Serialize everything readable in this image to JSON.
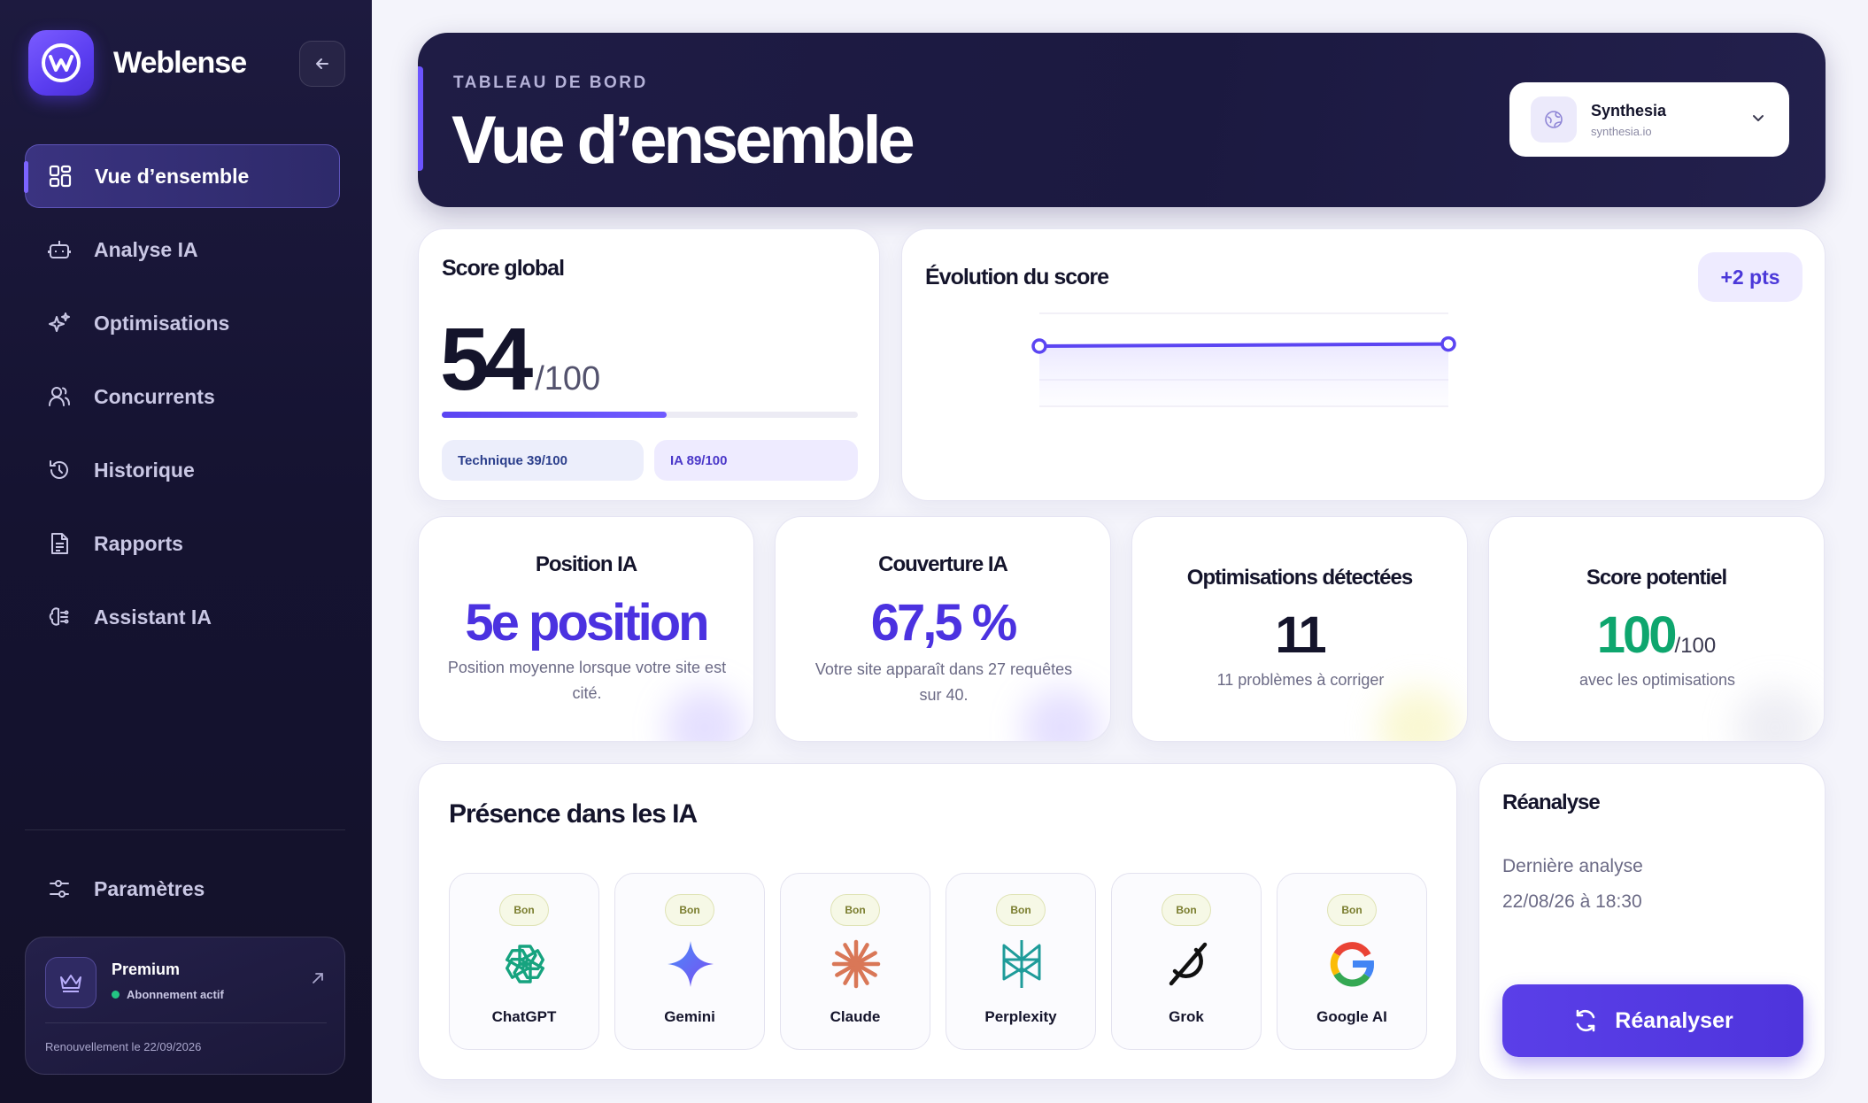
{
  "sidebar": {
    "brand_name": "Weblense",
    "nav": [
      {
        "label": "Vue d’ensemble",
        "icon": "grid-icon",
        "active": true
      },
      {
        "label": "Analyse IA",
        "icon": "robot-icon"
      },
      {
        "label": "Optimisations",
        "icon": "sparkles-icon"
      },
      {
        "label": "Concurrents",
        "icon": "users-icon"
      },
      {
        "label": "Historique",
        "icon": "history-icon"
      },
      {
        "label": "Rapports",
        "icon": "document-icon"
      },
      {
        "label": "Assistant IA",
        "icon": "brain-icon"
      }
    ],
    "settings_label": "Paramètres",
    "premium": {
      "title": "Premium",
      "status": "Abonnement actif",
      "renewal": "Renouvellement le 22/09/2026"
    }
  },
  "header": {
    "eyebrow": "TABLEAU DE BORD",
    "title": "Vue d’ensemble",
    "site": {
      "name": "Synthesia",
      "url": "synthesia.io"
    }
  },
  "score": {
    "title": "Score global",
    "value": "54",
    "max": "/100",
    "progress": 0.54,
    "technique": "Technique 39/100",
    "ia": "IA 89/100"
  },
  "evolution": {
    "title": "Évolution du score",
    "delta": "+2 pts",
    "chart_data": {
      "type": "line",
      "series": [
        {
          "values": [
            52,
            54
          ]
        }
      ],
      "grid": true
    }
  },
  "kpis": [
    {
      "title": "Position IA",
      "value": "5e position",
      "sub": "Position moyenne lorsque votre site est cité.",
      "color": "#4b32e0"
    },
    {
      "title": "Couverture IA",
      "value": "67,5 %",
      "sub": "Votre site apparaît dans 27 requêtes sur 40.",
      "color": "#4b32e0"
    },
    {
      "title": "Optimisations détectées",
      "value": "11",
      "sub": "11 problèmes à corriger",
      "color": "#14142b"
    },
    {
      "title": "Score potentiel",
      "value": "100",
      "value_suffix": "/100",
      "sub": "avec les optimisations",
      "color": "#0ea66e"
    }
  ],
  "presence": {
    "title": "Présence dans les IA",
    "items": [
      {
        "name": "ChatGPT",
        "badge": "Bon",
        "icon": "chatgpt-icon"
      },
      {
        "name": "Gemini",
        "badge": "Bon",
        "icon": "gemini-icon"
      },
      {
        "name": "Claude",
        "badge": "Bon",
        "icon": "claude-icon"
      },
      {
        "name": "Perplexity",
        "badge": "Bon",
        "icon": "perplexity-icon"
      },
      {
        "name": "Grok",
        "badge": "Bon",
        "icon": "grok-icon"
      },
      {
        "name": "Google AI",
        "badge": "Bon",
        "icon": "google-icon"
      }
    ]
  },
  "reanalyse": {
    "title": "Réanalyse",
    "last_label": "Dernière analyse",
    "last_date": "22/08/26 à 18:30",
    "button": "Réanalyser"
  },
  "colors": {
    "accent": "#5b45f2",
    "sidebar": "#151331",
    "success": "#0ea66e"
  }
}
